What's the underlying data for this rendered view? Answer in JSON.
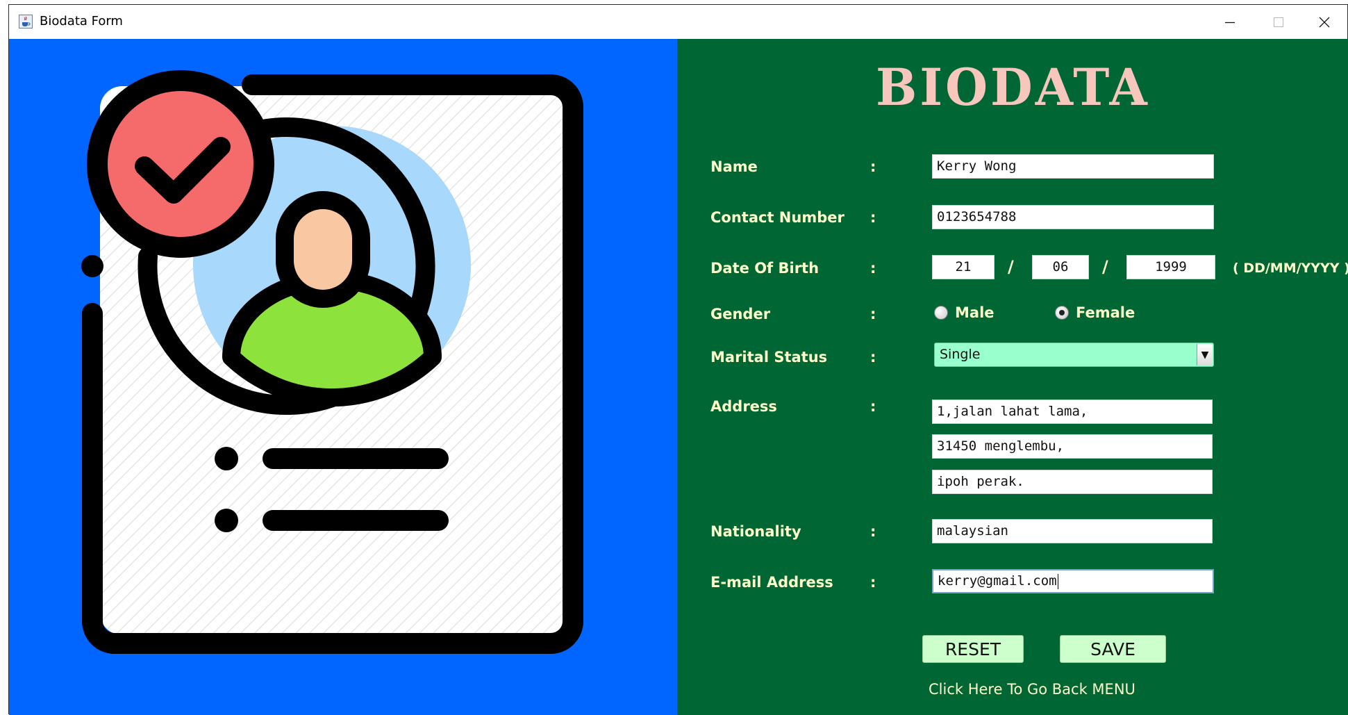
{
  "window": {
    "title": "Biodata Form"
  },
  "form": {
    "heading": "BIODATA",
    "labels": {
      "name": "Name",
      "contact": "Contact Number",
      "dob": "Date Of Birth",
      "gender": "Gender",
      "marital": "Marital Status",
      "address": "Address",
      "nationality": "Nationality",
      "email": "E-mail Address"
    },
    "colon": ":",
    "values": {
      "name": "Kerry Wong",
      "contact": "0123654788",
      "dob_day": "21",
      "dob_month": "06",
      "dob_year": "1999",
      "address_1": "1,jalan lahat lama,",
      "address_2": "31450 menglembu,",
      "address_3": "ipoh perak.",
      "nationality": "malaysian",
      "email": "kerry@gmail.com"
    },
    "date_separator": "/",
    "date_format": "( DD/MM/YYYY )",
    "gender_options": [
      "Male",
      "Female"
    ],
    "gender_selected": "Female",
    "marital_selected": "Single",
    "reset_label": "RESET",
    "save_label": "SAVE",
    "back_link": "Click Here To Go Back MENU"
  },
  "colors": {
    "left_panel": "#0066ff",
    "right_panel": "#006633",
    "label_text": "#ffffcc",
    "heading": "#f7c6bd",
    "combo_bg": "#99ffcc",
    "button_bg": "#ccffcc"
  },
  "icons": {
    "app": "java-cup-icon",
    "illustration": "biodata-document-illustration"
  }
}
